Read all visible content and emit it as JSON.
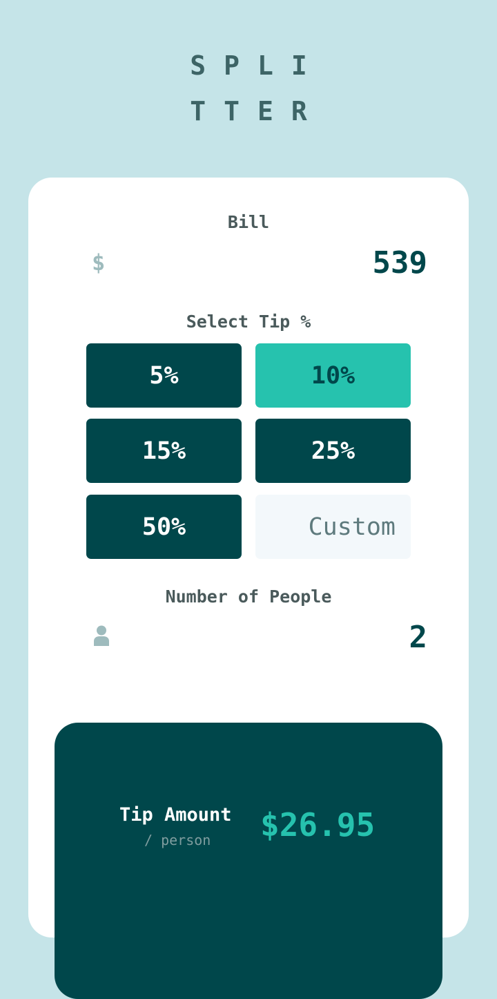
{
  "header": {
    "logo_line1": "SPLI",
    "logo_line2": "TTER"
  },
  "bill": {
    "label": "Bill",
    "currency_icon": "dollar-icon",
    "value": "539"
  },
  "tip": {
    "label": "Select Tip %",
    "options": [
      "5%",
      "10%",
      "15%",
      "25%",
      "50%"
    ],
    "selected": "10%",
    "custom_placeholder": "Custom"
  },
  "people": {
    "label": "Number of People",
    "icon": "person-icon",
    "value": "2"
  },
  "result": {
    "tip_amount_label": "Tip Amount",
    "per_person_label": "/ person",
    "tip_amount_value": "$26.95"
  },
  "colors": {
    "background": "#c5e4e8",
    "dark_cyan": "#00474b",
    "strong_cyan": "#26c2ae",
    "grayish_cyan": "#9ebbbd"
  }
}
